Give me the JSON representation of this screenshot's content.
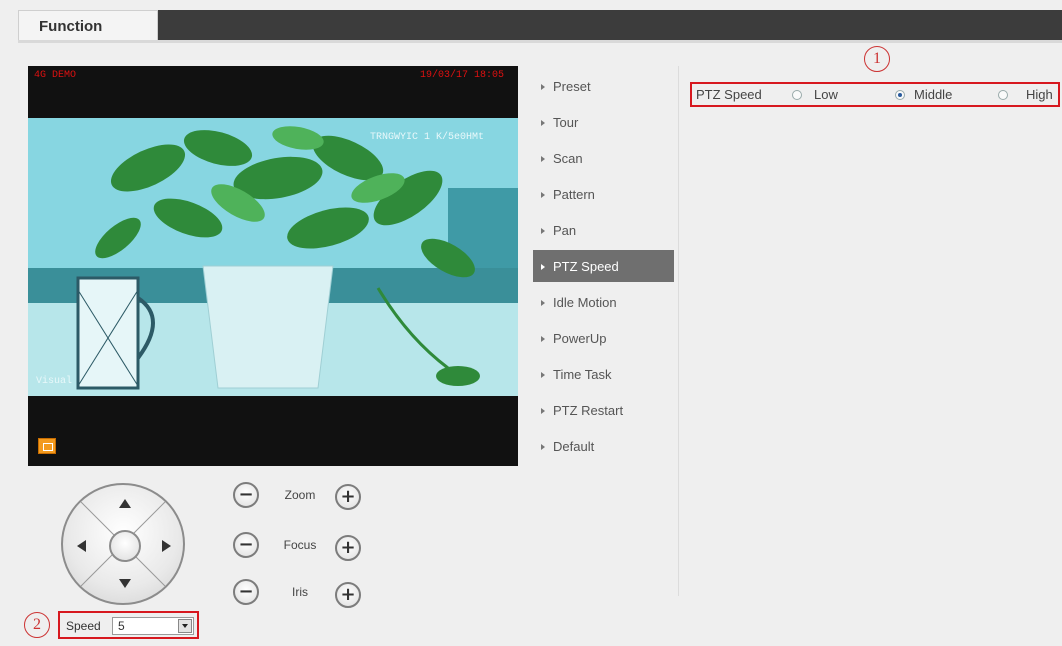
{
  "tabs": {
    "active_label": "Function"
  },
  "video": {
    "osd_top_left": "4G DEMO",
    "osd_top_right": "19/03/17 18:05",
    "osd_overlay": "TRNGWYIC 1 K/5e0HMt",
    "osd_channel": "Visual"
  },
  "controls": {
    "zoom_label": "Zoom",
    "focus_label": "Focus",
    "iris_label": "Iris",
    "minus_glyph": "−",
    "plus_glyph": "+"
  },
  "speed": {
    "label": "Speed",
    "value": "5"
  },
  "callouts": {
    "one": "1",
    "two": "2"
  },
  "menu": {
    "items": [
      {
        "label": "Preset"
      },
      {
        "label": "Tour"
      },
      {
        "label": "Scan"
      },
      {
        "label": "Pattern"
      },
      {
        "label": "Pan"
      },
      {
        "label": "PTZ Speed"
      },
      {
        "label": "Idle Motion"
      },
      {
        "label": "PowerUp"
      },
      {
        "label": "Time Task"
      },
      {
        "label": "PTZ Restart"
      },
      {
        "label": "Default"
      }
    ],
    "active": "PTZ Speed"
  },
  "ptz_speed": {
    "label": "PTZ Speed",
    "options": [
      "Low",
      "Middle",
      "High"
    ],
    "selected": "Middle"
  },
  "colors": {
    "highlight_border": "#d7181f",
    "menu_active_bg": "#6f6f6f",
    "tabbar_bg": "#3c3c3c"
  }
}
